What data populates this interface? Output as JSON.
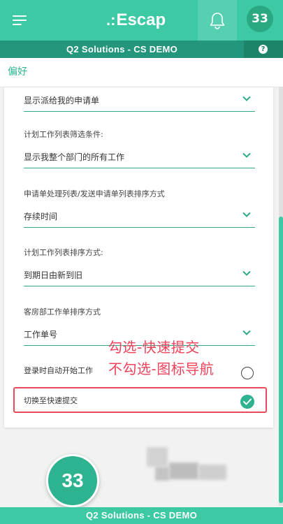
{
  "header": {
    "logo_text": "Escap",
    "logo_dots": ".:",
    "badge_count": "33",
    "accent_color": "#3cc9a4",
    "icons": [
      "menu-icon",
      "bell-icon",
      "help-icon"
    ]
  },
  "subheader": {
    "title": "Q2 Solutions - CS DEMO",
    "help_glyph": "?"
  },
  "section": {
    "title": "偏好"
  },
  "fields": [
    {
      "label": "",
      "value": "显示派给我的申请单"
    },
    {
      "label": "计划工作列表筛选条件:",
      "value": "显示我整个部门的所有工作"
    },
    {
      "label": "申请单处理列表/发送申请单列表排序方式",
      "value": "存续时间"
    },
    {
      "label": "计划工作列表排序方式:",
      "value": "到期日由新到旧"
    },
    {
      "label": "客房部工作单排序方式",
      "value": "工作单号"
    }
  ],
  "toggles": [
    {
      "label": "登录时自动开始工作",
      "checked": false
    },
    {
      "label": "切换至快速提交",
      "checked": true
    }
  ],
  "annotation": {
    "line1": "勾选-快速提交",
    "line2": "不勾选-图标导航",
    "color": "#f0425a"
  },
  "footer": {
    "badge_count": "33",
    "title": "Q2 Solutions - CS DEMO"
  }
}
